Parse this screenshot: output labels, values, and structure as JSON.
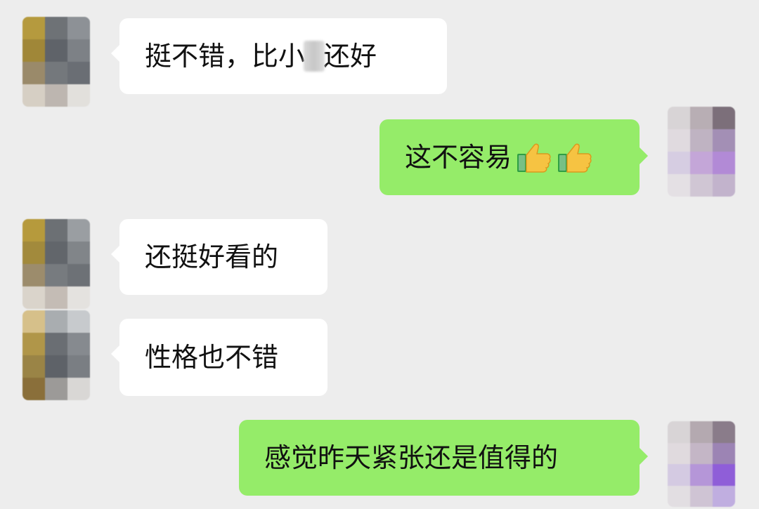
{
  "messages": [
    {
      "side": "left",
      "text_before": "挺不错，比小",
      "text_after": "还好",
      "avatar": "pixelated-avatar-a"
    },
    {
      "side": "right",
      "text": "这不容易",
      "emoji": [
        "thumbs-up-icon",
        "thumbs-up-icon"
      ],
      "avatar": "pixelated-avatar-b"
    },
    {
      "side": "left",
      "text": "还挺好看的",
      "avatar": "pixelated-avatar-a"
    },
    {
      "side": "left",
      "text": "性格也不错",
      "avatar": "pixelated-avatar-a"
    },
    {
      "side": "right",
      "text": "感觉昨天紧张还是值得的",
      "avatar": "pixelated-avatar-b"
    }
  ],
  "colors": {
    "background": "#ededed",
    "bubble_left": "#ffffff",
    "bubble_right": "#95ec69",
    "text": "#111111"
  }
}
